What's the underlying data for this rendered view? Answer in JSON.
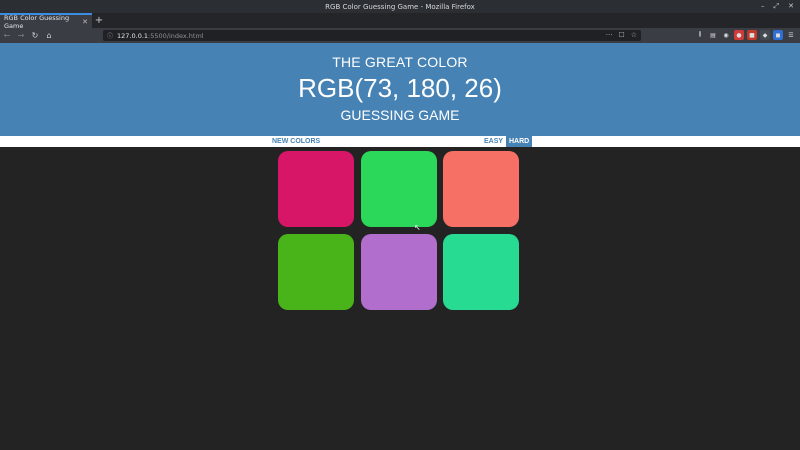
{
  "window": {
    "title": "RGB Color Guessing Game - Mozilla Firefox",
    "controls": [
      "–",
      "⤢",
      "✕"
    ]
  },
  "tabs": [
    {
      "label": "RGB Color Guessing Game",
      "close": "✕"
    }
  ],
  "new_tab": "+",
  "nav": {
    "back": "←",
    "forward": "→",
    "reload": "↻",
    "home": "⌂"
  },
  "url": {
    "host": "127.0.0.1",
    "path": ":5500/index.html",
    "actions": [
      "···",
      "☐",
      "☆"
    ]
  },
  "toolbar_icons": [
    {
      "name": "library-icon",
      "glyph": "⫼",
      "color": "#3a3e44"
    },
    {
      "name": "sidebar-icon",
      "glyph": "▤",
      "color": "#3a3e44"
    },
    {
      "name": "account-icon",
      "glyph": "◉",
      "color": "#3a3e44"
    },
    {
      "name": "extension-red-icon",
      "glyph": "●",
      "color": "#d23a3a"
    },
    {
      "name": "extension-adblock-icon",
      "glyph": "■",
      "color": "#c0392b"
    },
    {
      "name": "extension-dark-icon",
      "glyph": "◆",
      "color": "#444a52"
    },
    {
      "name": "extension-blue-icon",
      "glyph": "◼",
      "color": "#2f6fd1"
    },
    {
      "name": "menu-icon",
      "glyph": "☰",
      "color": "#3a3e44"
    }
  ],
  "game": {
    "title_top": "THE GREAT COLOR",
    "rgb_display": "RGB(73, 180, 26)",
    "title_bottom": "GUESSING GAME",
    "new_colors": "NEW COLORS",
    "easy": "EASY",
    "hard": "HARD",
    "accent": "#4682b4",
    "squares": [
      "#d81668",
      "#2bd85a",
      "#f77066",
      "#49b41a",
      "#b26ecd",
      "#27dc92"
    ]
  }
}
